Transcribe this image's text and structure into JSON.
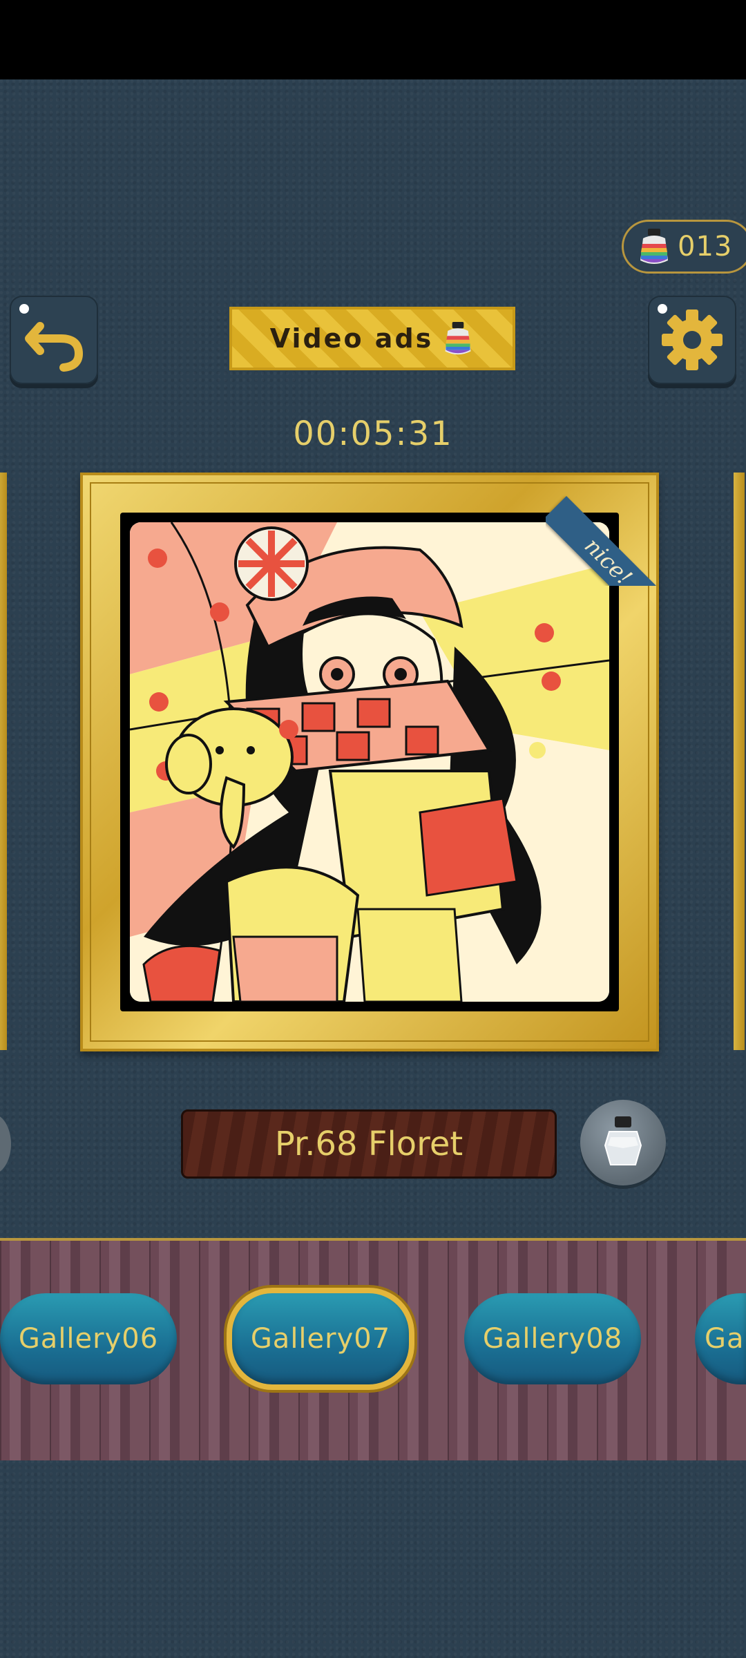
{
  "ink_counter": {
    "value": "013",
    "icon": "rainbow-ink-bottle-icon"
  },
  "buttons": {
    "back_icon": "back-arrow-icon",
    "settings_icon": "gear-icon",
    "video_ads_label": "Video ads"
  },
  "timer": "00:05:31",
  "artwork": {
    "badge": "nice!"
  },
  "title_plate": "Pr.68 Floret",
  "galleries": [
    {
      "label": "Gallery06",
      "active": false
    },
    {
      "label": "Gallery07",
      "active": true
    },
    {
      "label": "Gallery08",
      "active": false
    },
    {
      "label": "Ga",
      "active": false
    }
  ],
  "colors": {
    "accent_gold": "#e6cf6a",
    "background": "#2c4050",
    "gallery_button": "#1a6f93"
  }
}
